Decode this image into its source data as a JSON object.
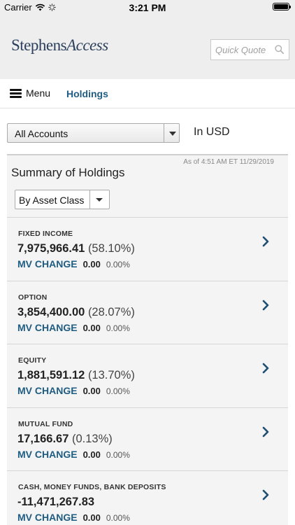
{
  "status_bar": {
    "carrier": "Carrier",
    "time": "3:21 PM"
  },
  "header": {
    "logo_main": "Stephens",
    "logo_italic": "Access",
    "quick_quote_placeholder": "Quick Quote"
  },
  "nav": {
    "menu_label": "Menu",
    "holdings_label": "Holdings"
  },
  "accounts": {
    "selected": "All Accounts",
    "currency": "In USD"
  },
  "summary": {
    "as_of": "As of  4:51 AM ET 11/29/2019",
    "title": "Summary of Holdings",
    "group_by": "By Asset Class",
    "mv_change_label": "MV CHANGE",
    "rows": [
      {
        "category": "FIXED INCOME",
        "value": "7,975,966.41",
        "percent": "(58.10%)",
        "mv_amount": "0.00",
        "mv_percent": "0.00%"
      },
      {
        "category": "OPTION",
        "value": "3,854,400.00",
        "percent": "(28.07%)",
        "mv_amount": "0.00",
        "mv_percent": "0.00%"
      },
      {
        "category": "EQUITY",
        "value": "1,881,591.12",
        "percent": "(13.70%)",
        "mv_amount": "0.00",
        "mv_percent": "0.00%"
      },
      {
        "category": "MUTUAL FUND",
        "value": "17,166.67",
        "percent": "(0.13%)",
        "mv_amount": "0.00",
        "mv_percent": "0.00%"
      },
      {
        "category": "CASH, MONEY FUNDS, BANK DEPOSITS",
        "value": "-11,471,267.83",
        "percent": "",
        "mv_amount": "0.00",
        "mv_percent": "0.00%"
      }
    ]
  },
  "colors": {
    "accent": "#1f5c82",
    "logo": "#2b3f5c",
    "header_bg": "#eeeeee",
    "panel_bg": "#f4f4f4"
  },
  "icons": {
    "search": "search-icon",
    "chevron": "chevron-right-icon",
    "menu": "hamburger-icon"
  }
}
